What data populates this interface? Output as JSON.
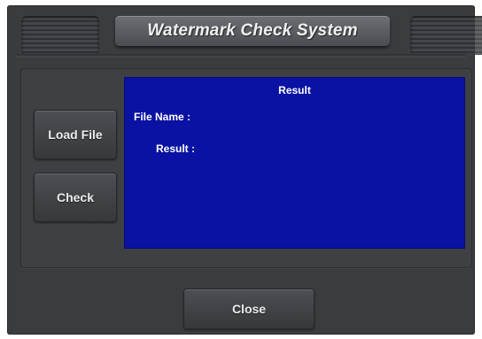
{
  "window": {
    "title": "Watermark Check System"
  },
  "buttons": {
    "load_file": "Load File",
    "check": "Check",
    "close": "Close"
  },
  "result_panel": {
    "title": "Result",
    "file_name_label": "File Name :",
    "file_name_value": "",
    "result_label": "Result :",
    "result_value": ""
  },
  "colors": {
    "window_bg": "#3a3c3f",
    "result_bg": "#0a12a3",
    "text": "#ffffff"
  }
}
